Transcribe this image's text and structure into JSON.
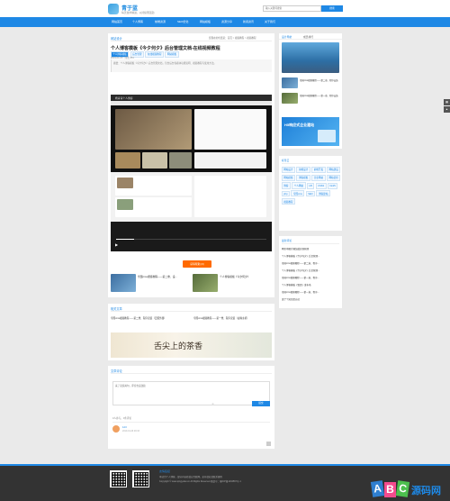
{
  "header": {
    "site_name": "青于蓝",
    "slogan": "每天技术精进，以持续而强劲",
    "search_placeholder": "输入关键词搜索",
    "search_button": "搜索"
  },
  "nav": {
    "items": [
      "网站首页",
      "个人博客",
      "前端资源",
      "SEO优化",
      "网站模板",
      "资源分享",
      "新闻资讯",
      "关于我们"
    ]
  },
  "breadcrumb": "您现在的位置是：首页 > 视频教程 > 视频教程",
  "article": {
    "section_label": "网站设计",
    "title": "个人博客模板《今夕何夕》后台管理文档-在线视频教程",
    "tags": [
      "个人博客模板",
      "后台管理",
      "在线视频教程",
      "网站模板"
    ],
    "meta": "2019-01-05 · 阅读 853",
    "summary": "摘要：个人博客模板《今夕何夕》后台管理文档，包含后台各模块功能说明、视频教程与使用方法。",
    "video_title": "杨青青个人博客",
    "download_button": "获得帮助 (0)",
    "author_note": "归档发布于青于蓝网站，第一时间找到更多内容",
    "author_link": "本文链接：www.qingyulan.cn/blog",
    "prev_label": "帝国cms视频教程——第二章、设...",
    "next_label": "个人博客模板《今夕何夕》"
  },
  "related": {
    "title": "相关文章",
    "items": [
      "帝国cms视频教程——第二章、程序安装（云服务器）",
      "帝国cms视频教程——第一章、程序安装（虚拟主机）"
    ],
    "banner_text": "舌尖上的茶香"
  },
  "comments": {
    "title": "文章评论",
    "placeholder": "来了就说两句，评论也是鼓励",
    "submit_button": "提交",
    "count_text": "0人参与，0条评论",
    "user": "123",
    "user_time": "2019-01-06 09:33"
  },
  "sidebar": {
    "tabs": [
      "设计导航",
      "成员排行"
    ],
    "news": [
      {
        "title": "帝国cms视频教程——第二章、程序安装"
      },
      {
        "title": "帝国cms视频教程——第一章、程序安装"
      }
    ],
    "banner_text": "H5响应式企业建站",
    "tag_section_title": "标签云",
    "tags": [
      "网站设计",
      "前端设计",
      "前端开发",
      "网站建设",
      "网站模板",
      "博客模板",
      "企业网站",
      "网站优化",
      "博客",
      "个人网站",
      "H5",
      "CSS3",
      "html5",
      "php",
      "帝国cms",
      "SEO",
      "博客建站",
      "视频教程"
    ],
    "latest_title": "最新评论",
    "latest_items": [
      "网页中图片懒加载实现原理",
      "个人博客模板《今夕何夕》后台管理...",
      "帝国cms视频教程——第二章、程序...",
      "个人博客模板《今夕何夕》后台管理...",
      "帝国cms视频教程——第一章、程序...",
      "个人博客模板《雪见》发布啦",
      "帝国cms视频教程——第一章、程序...",
      "发了个短信给自己"
    ]
  },
  "footer": {
    "links_title": "友情链接",
    "line1": "本站为个人博客，部分内容转载自互联网，如有侵权请联系删除",
    "line2": "Copyright © www.qingyulan.cn All Rights Reserved 备案号：蜀ICP备1234567号-1",
    "watermark": "源码网"
  },
  "colors": {
    "accent": "#1e88e5",
    "download": "#ff6a00",
    "footer": "#333333"
  }
}
